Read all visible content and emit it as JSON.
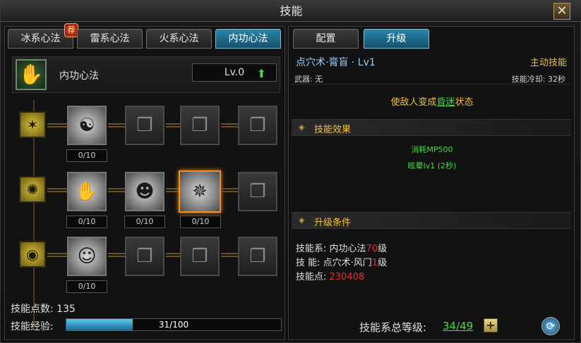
{
  "window": {
    "title": "技能",
    "close_glyph": "✕"
  },
  "left_tabs": [
    {
      "label": "冰系心法",
      "active": false,
      "badge": "荐"
    },
    {
      "label": "雷系心法",
      "active": false
    },
    {
      "label": "火系心法",
      "active": false
    },
    {
      "label": "内功心法",
      "active": true
    }
  ],
  "school": {
    "name": "内功心法",
    "level": "Lv.0",
    "icon": "hand-icon"
  },
  "rows": [
    {
      "school_icon": "crack-icon",
      "skills": [
        {
          "icon": "monk-icon",
          "state": "learnable",
          "counter": "0/10"
        },
        {
          "icon": "locked-book-icon",
          "state": "locked"
        },
        {
          "icon": "locked-book-icon",
          "state": "locked"
        },
        {
          "icon": "locked-book-icon",
          "state": "locked"
        }
      ]
    },
    {
      "school_icon": "rays-icon",
      "skills": [
        {
          "icon": "claw-icon",
          "state": "learnable",
          "counter": "0/10"
        },
        {
          "icon": "head-icon",
          "state": "learnable",
          "counter": "0/10"
        },
        {
          "icon": "vortex-icon",
          "state": "selected",
          "counter": "0/10"
        },
        {
          "icon": "locked-book-icon",
          "state": "locked"
        }
      ]
    },
    {
      "school_icon": "eye-icon",
      "skills": [
        {
          "icon": "elder-icon",
          "state": "learnable",
          "counter": "0/10"
        },
        {
          "icon": "locked-book-icon",
          "state": "locked"
        },
        {
          "icon": "locked-book-icon",
          "state": "locked"
        },
        {
          "icon": "locked-book-icon",
          "state": "locked"
        }
      ]
    }
  ],
  "footer_left": {
    "points_label": "技能点数:",
    "points_value": "135",
    "exp_label": "技能经验:",
    "exp_current": 31,
    "exp_max": 100,
    "exp_text": "31/100"
  },
  "right_tabs": [
    {
      "label": "配置",
      "active": false
    },
    {
      "label": "升级",
      "active": true
    }
  ],
  "detail": {
    "name": "点穴术·膏盲 · Lv1",
    "kind": "主动技能",
    "weapon": "武器: 无",
    "cooldown": "技能冷却: 32秒",
    "desc_prefix": "使敌人变成",
    "desc_highlight": "昏迷",
    "desc_suffix": "状态",
    "effect_title": "技能效果",
    "effects": [
      "消耗MP500",
      "眩晕lv1 (2秒)"
    ],
    "req_title": "升级条件",
    "req1_label": "技能系: 内功心法",
    "req1_num": "70",
    "req1_suffix": "级",
    "req2_label": "技  能: 点穴术·风门",
    "req2_num": "1",
    "req2_suffix": "级",
    "req3_label": "技能点: ",
    "req3_num": "230408"
  },
  "footer_right": {
    "total_label": "技能系总等级:",
    "total_value": "34/49"
  },
  "colors": {
    "accent_blue": "#2b86a8",
    "gold": "#f0c040",
    "green": "#48d848",
    "red": "#e83030",
    "selected_border": "#f09020"
  }
}
